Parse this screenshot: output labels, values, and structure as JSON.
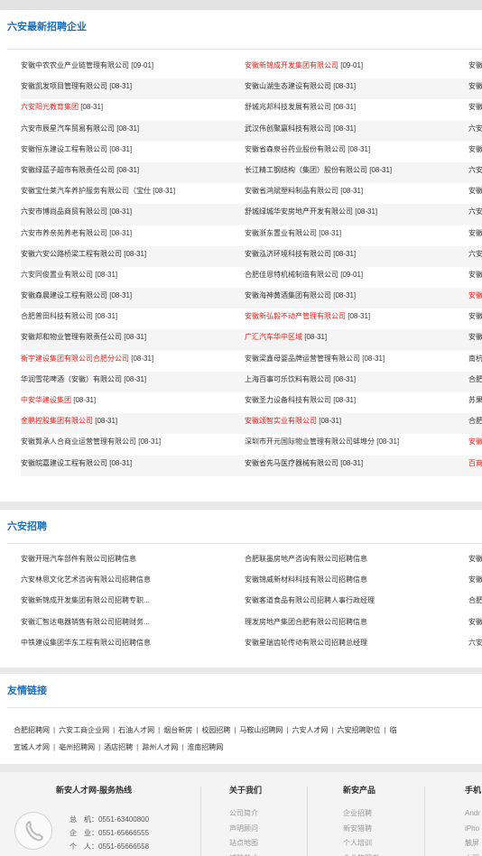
{
  "latest": {
    "title": "六安最新招聘企业",
    "rows": [
      [
        {
          "name": "安徽中农农业产业链管理有限公司",
          "date": "[09-01]",
          "hl": false
        },
        {
          "name": "安徽新锦成开发集团有限公司",
          "date": "[09-01]",
          "hl": true
        },
        {
          "name": "安徽",
          "date": "",
          "hl": false
        }
      ],
      [
        {
          "name": "安徽凯发项目管理有限公司",
          "date": "[08-31]",
          "hl": false
        },
        {
          "name": "安徽山湖生态建设有限公司",
          "date": "[08-31]",
          "hl": false
        },
        {
          "name": "安徽",
          "date": "",
          "hl": false
        }
      ],
      [
        {
          "name": "六安阳光教育集团",
          "date": "[08-31]",
          "hl": true
        },
        {
          "name": "舒城兆邦科技发展有限公司",
          "date": "[08-31]",
          "hl": false
        },
        {
          "name": "安徽",
          "date": "",
          "hl": false
        }
      ],
      [
        {
          "name": "六安市辰星汽车贸易有限公司",
          "date": "[08-31]",
          "hl": false
        },
        {
          "name": "武汉伟创聚赢科技有限公司",
          "date": "[08-31]",
          "hl": false
        },
        {
          "name": "六安",
          "date": "",
          "hl": false
        }
      ],
      [
        {
          "name": "安徽恒东建设工程有限公司",
          "date": "[08-31]",
          "hl": false
        },
        {
          "name": "安徽省森泉谷药业股份有限公司",
          "date": "[08-31]",
          "hl": false
        },
        {
          "name": "安徽",
          "date": "",
          "hl": false
        }
      ],
      [
        {
          "name": "安徽绿蓝子超市有限责任公司",
          "date": "[08-31]",
          "hl": false
        },
        {
          "name": "长江精工钢结构（集团）股份有限公司",
          "date": "[08-31]",
          "hl": false
        },
        {
          "name": "六安",
          "date": "",
          "hl": false
        }
      ],
      [
        {
          "name": "安徽宝仕莱汽车养护服务有限公司（宝仕",
          "date": "[08-31]",
          "hl": false
        },
        {
          "name": "安徽省鸿斌塑料制品有限公司",
          "date": "[08-31]",
          "hl": false
        },
        {
          "name": "安徽",
          "date": "",
          "hl": false
        }
      ],
      [
        {
          "name": "六安市博尚品商贸有限公司",
          "date": "[08-31]",
          "hl": false
        },
        {
          "name": "舒城绿城华安房地产开发有限公司",
          "date": "[08-31]",
          "hl": false
        },
        {
          "name": "六安",
          "date": "",
          "hl": false
        }
      ],
      [
        {
          "name": "六安市养亲苑养老有限公司",
          "date": "[08-31]",
          "hl": false
        },
        {
          "name": "安徽浙东置业有限公司",
          "date": "[08-31]",
          "hl": false
        },
        {
          "name": "安徽",
          "date": "",
          "hl": false
        }
      ],
      [
        {
          "name": "安徽六安公路桥梁工程有限公司",
          "date": "[08-31]",
          "hl": false
        },
        {
          "name": "安徽泓济环境科技有限公司",
          "date": "[08-31]",
          "hl": false
        },
        {
          "name": "六安",
          "date": "",
          "hl": false
        }
      ],
      [
        {
          "name": "六安同俊置业有限公司",
          "date": "[08-31]",
          "hl": false
        },
        {
          "name": "合肥佳恩特机械制造有限公司",
          "date": "[09-01]",
          "hl": false
        },
        {
          "name": "安徽",
          "date": "",
          "hl": false
        }
      ],
      [
        {
          "name": "安徽森晨建设工程有限公司",
          "date": "[08-31]",
          "hl": false
        },
        {
          "name": "安徽海神黄酒集团有限公司",
          "date": "[08-31]",
          "hl": false
        },
        {
          "name": "安徽",
          "date": "",
          "hl": true
        }
      ],
      [
        {
          "name": "合肥普田科技有限公司",
          "date": "[08-31]",
          "hl": false
        },
        {
          "name": "安徽新弘毅不动产管理有限公司",
          "date": "[08-31]",
          "hl": true
        },
        {
          "name": "安徽",
          "date": "",
          "hl": false
        }
      ],
      [
        {
          "name": "安徽邦和物业管理有限责任公司",
          "date": "[08-31]",
          "hl": false
        },
        {
          "name": "广汇汽车华中区域",
          "date": "[08-31]",
          "hl": true
        },
        {
          "name": "安徽",
          "date": "",
          "hl": false
        }
      ],
      [
        {
          "name": "衡宇建设集团有限公司合肥分公司",
          "date": "[08-31]",
          "hl": true
        },
        {
          "name": "安徽梁鑫母婴品牌运营管理有限公司",
          "date": "[08-31]",
          "hl": false
        },
        {
          "name": "南杭",
          "date": "",
          "hl": false
        }
      ],
      [
        {
          "name": "华润雪花啤酒（安徽）有限公司",
          "date": "[08-31]",
          "hl": false
        },
        {
          "name": "上海百事可乐饮料有限公司",
          "date": "[08-31]",
          "hl": false
        },
        {
          "name": "合肥",
          "date": "",
          "hl": false
        }
      ],
      [
        {
          "name": "中安华建设集团",
          "date": "[08-31]",
          "hl": true
        },
        {
          "name": "安徽圣力设备科技有限公司",
          "date": "[08-31]",
          "hl": false
        },
        {
          "name": "苏果",
          "date": "",
          "hl": false
        }
      ],
      [
        {
          "name": "金鹏控股集团有限公司",
          "date": "[08-31]",
          "hl": true
        },
        {
          "name": "安徽颂智实业有限公司",
          "date": "[08-31]",
          "hl": true
        },
        {
          "name": "合肥",
          "date": "",
          "hl": false
        }
      ],
      [
        {
          "name": "安徽賢承人合商业运营管理有限公司",
          "date": "[08-31]",
          "hl": false
        },
        {
          "name": "深圳市开元国际物业管理有限公司蚌埠分",
          "date": "[08-31]",
          "hl": false
        },
        {
          "name": "安徽",
          "date": "",
          "hl": true
        }
      ],
      [
        {
          "name": "安徽皖嘉建设工程有限公司",
          "date": "[08-31]",
          "hl": false
        },
        {
          "name": "安徽省先马医疗器械有限公司",
          "date": "[08-31]",
          "hl": false
        },
        {
          "name": "百商",
          "date": "",
          "hl": true
        }
      ]
    ]
  },
  "recruit": {
    "title": "六安招聘",
    "rows": [
      [
        "安徽开瑶汽车部件有限公司招聘信息",
        "合肥联墨房地产咨询有限公司招聘信息",
        "安徽"
      ],
      [
        "六安林思文化艺术咨询有限公司招聘信息",
        "安徽锦威新材料科技有限公司招聘信息",
        "安徽"
      ],
      [
        "安徽新锦成开发集团有限公司招聘专职...",
        "安徽客道食品有限公司招聘人事行政经理",
        "合肥"
      ],
      [
        "安徽汇智达电器销售有限公司招聘财务...",
        "理发房地产集团合肥有限公司招聘信息",
        "安徽"
      ],
      [
        "中铁建设集团华东工程有限公司招聘信息",
        "安徽星瑞齿轮传动有限公司招聘总经理",
        "六安"
      ]
    ]
  },
  "friend_links": {
    "title": "友情链接",
    "line1": [
      "合肥招聘网",
      "六安工商企业网",
      "石油人才网",
      "烟台新房",
      "校园招聘",
      "马鞍山招聘网",
      "六安人才网",
      "六安招聘职位",
      "临"
    ],
    "line2": [
      "宣城人才网",
      "亳州招聘网",
      "酒店招聘",
      "滁州人才网",
      "淮南招聘网"
    ],
    "separator": "|"
  },
  "footer": {
    "service_title": "新安人才网-服务热线",
    "phones": [
      {
        "label": "总　机：",
        "number": "0551-63400800"
      },
      {
        "label": "企　业：",
        "number": "0551-65666555"
      },
      {
        "label": "个　人：",
        "number": "0551-65666558"
      }
    ],
    "about": {
      "title": "关于我们",
      "items": [
        "公司简介",
        "声明顾问",
        "站点地图",
        "诚聘英才"
      ]
    },
    "products": {
      "title": "新安产品",
      "items": [
        "企业招聘",
        "新安猎聘",
        "个人培训",
        "企业管理者"
      ]
    },
    "mobile": {
      "title": "手机",
      "items": [
        "Andr",
        "iPho",
        "触屏",
        "小程"
      ]
    }
  }
}
